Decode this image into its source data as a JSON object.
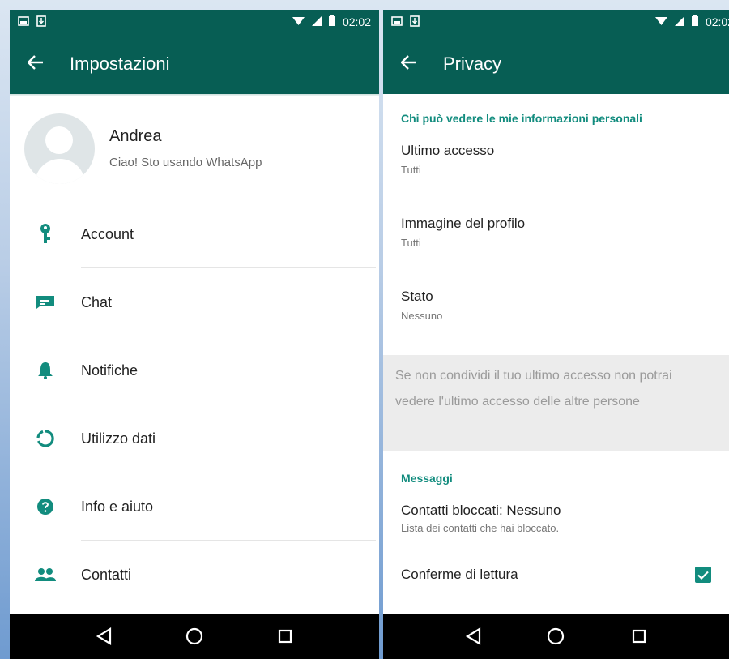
{
  "status_bar": {
    "time": "02:02"
  },
  "settings": {
    "title": "Impostazioni",
    "profile": {
      "name": "Andrea",
      "status": "Ciao! Sto usando WhatsApp"
    },
    "items": [
      {
        "label": "Account",
        "icon": "key-icon"
      },
      {
        "label": "Chat",
        "icon": "chat-icon"
      },
      {
        "label": "Notifiche",
        "icon": "bell-icon"
      },
      {
        "label": "Utilizzo dati",
        "icon": "data-usage-icon"
      },
      {
        "label": "Info e aiuto",
        "icon": "help-icon"
      },
      {
        "label": "Contatti",
        "icon": "contacts-icon"
      }
    ]
  },
  "privacy": {
    "title": "Privacy",
    "section_personal": "Chi può vedere le mie informazioni personali",
    "items": [
      {
        "title": "Ultimo accesso",
        "value": "Tutti"
      },
      {
        "title": "Immagine del profilo",
        "value": "Tutti"
      },
      {
        "title": "Stato",
        "value": "Nessuno"
      }
    ],
    "info_text": "Se non condividi il tuo ultimo accesso non potrai vedere l'ultimo accesso delle altre persone",
    "section_messages": "Messaggi",
    "blocked": {
      "title": "Contatti bloccati: Nessuno",
      "subtitle": "Lista dei contatti che hai bloccato."
    },
    "read_receipts": {
      "label": "Conferme di lettura",
      "checked": true
    }
  },
  "colors": {
    "primary": "#075e54",
    "accent": "#128c7e"
  }
}
